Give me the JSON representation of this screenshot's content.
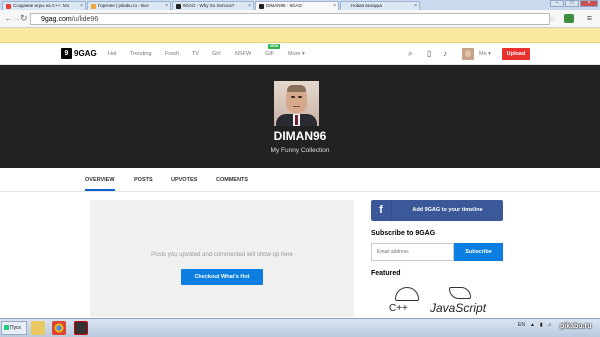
{
  "browser": {
    "tabs": [
      {
        "label": "Создание игры на C++: Мо",
        "favicon_color": "#e63b2e"
      },
      {
        "label": "Горячее | pikabu.ru - Все",
        "favicon_color": "#f0a63a"
      },
      {
        "label": "9GAG - Why So Serious?",
        "favicon_color": "#222222"
      },
      {
        "label": "DIMAN96 - 9GAG",
        "favicon_color": "#222222"
      },
      {
        "label": "Новая вкладка",
        "favicon_color": "#cccccc"
      }
    ],
    "url_host": "9gag.com",
    "url_path": "/u/lide96"
  },
  "gag_nav": {
    "logo_mark": "9",
    "logo_text": "9GAG",
    "links": [
      "Hot",
      "Trending",
      "Fresh",
      "TV",
      "Girl",
      "NSFW",
      "GIF",
      "More ▾"
    ],
    "new_badge": "NEW",
    "me_label": "Me ▾",
    "upload_label": "Upload"
  },
  "profile": {
    "username": "DIMAN96",
    "tagline": "My Funny Collection"
  },
  "tabs": [
    "OVERVIEW",
    "POSTS",
    "UPVOTES",
    "COMMENTS"
  ],
  "main": {
    "empty_text": "Posts you upvoted and commented will show up here",
    "checkout_label": "Checkout What's Hot"
  },
  "sidebar": {
    "fb_letter": "f",
    "fb_label": "Add 9GAG to your timeline",
    "subscribe_title": "Subscribe to 9GAG",
    "email_placeholder": "Email address",
    "subscribe_label": "Subscribe",
    "featured_title": "Featured",
    "featured_text_cpp": "C++",
    "featured_text_js": "JavaScript"
  },
  "taskbar": {
    "start_label": "Пуск",
    "lang": "EN"
  },
  "watermark": "pikabu.ru",
  "colors": {
    "upload": "#e8312f",
    "accent_blue": "#0b7ee0",
    "facebook": "#3b5998",
    "hero_bg": "#222222"
  }
}
